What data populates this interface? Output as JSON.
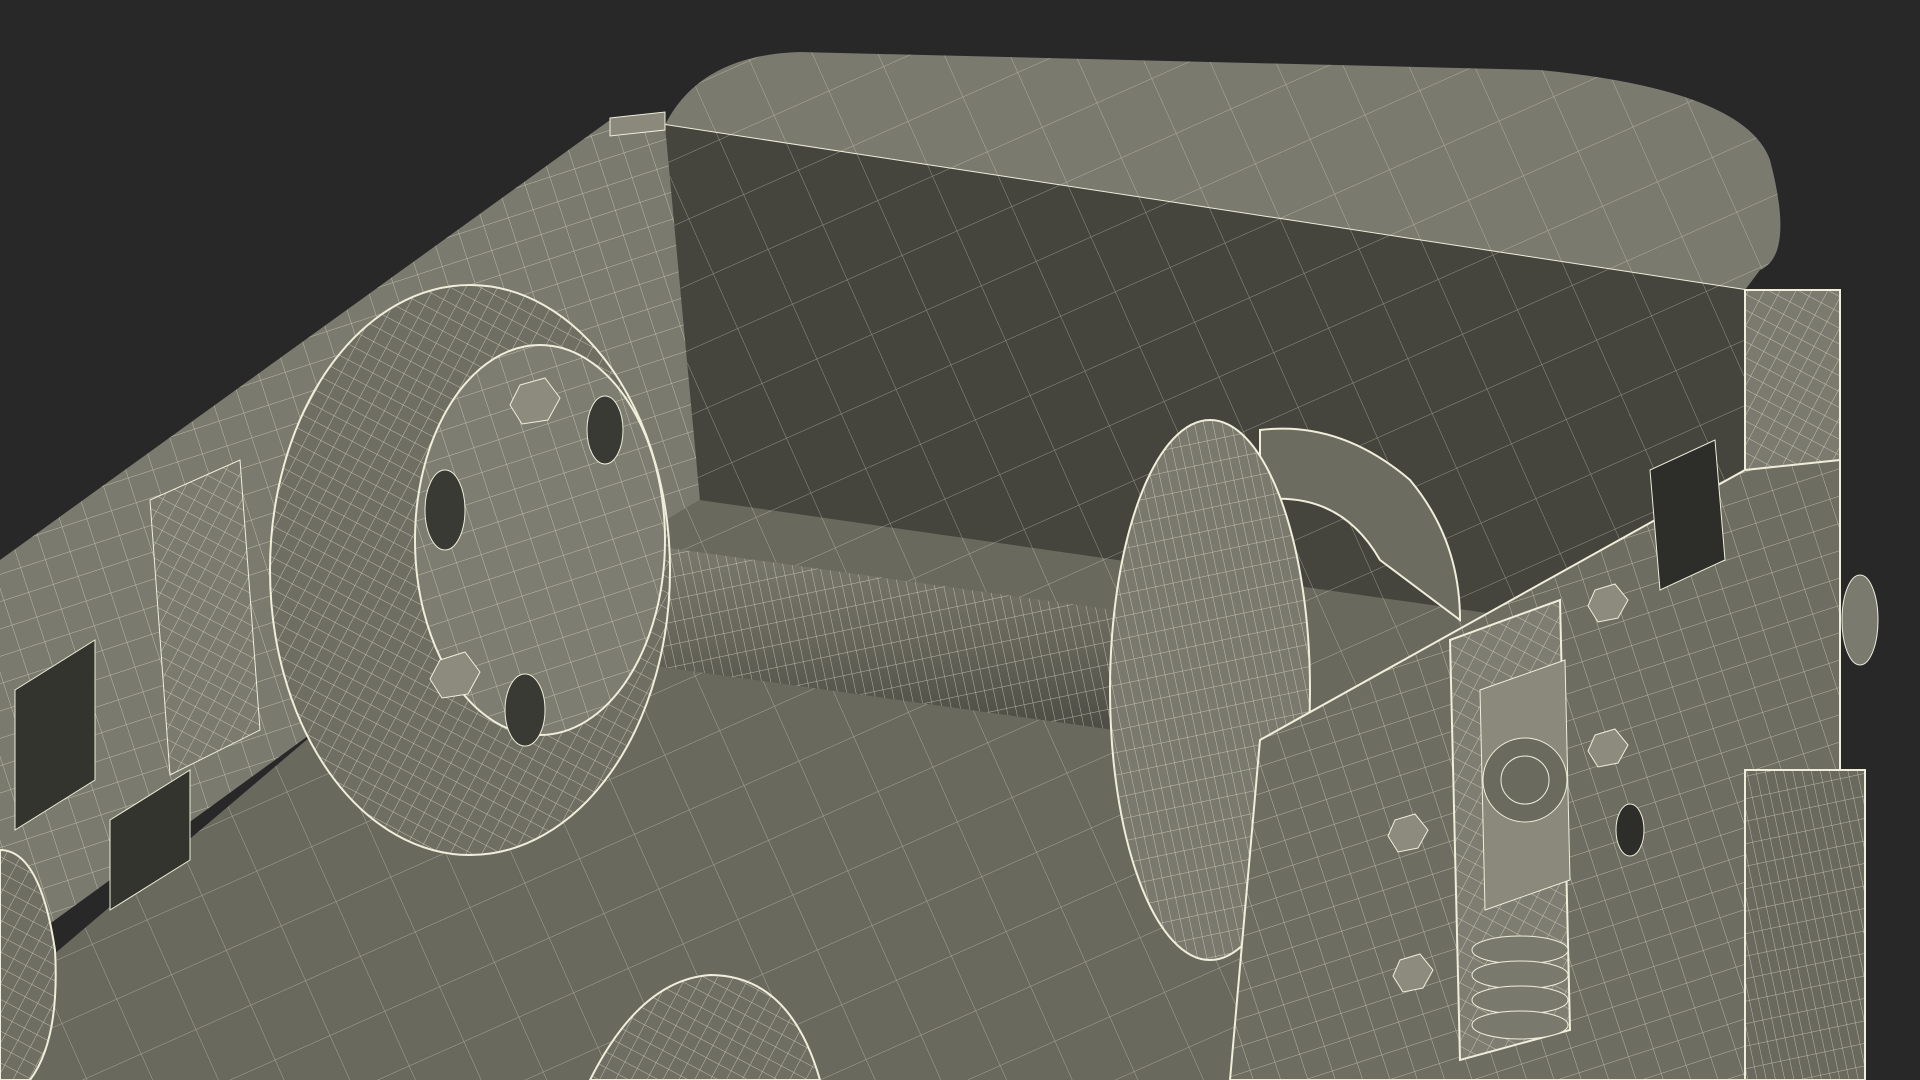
{
  "scene": {
    "subject": "wireframe-render-railcar-bogie-frame",
    "colors": {
      "background": "#282828",
      "surface_light": "#7b7a6e",
      "surface_mid": "#6a695e",
      "surface_dark": "#45453e",
      "surface_shadow": "#34342f",
      "wire": "#eeeeda"
    }
  }
}
